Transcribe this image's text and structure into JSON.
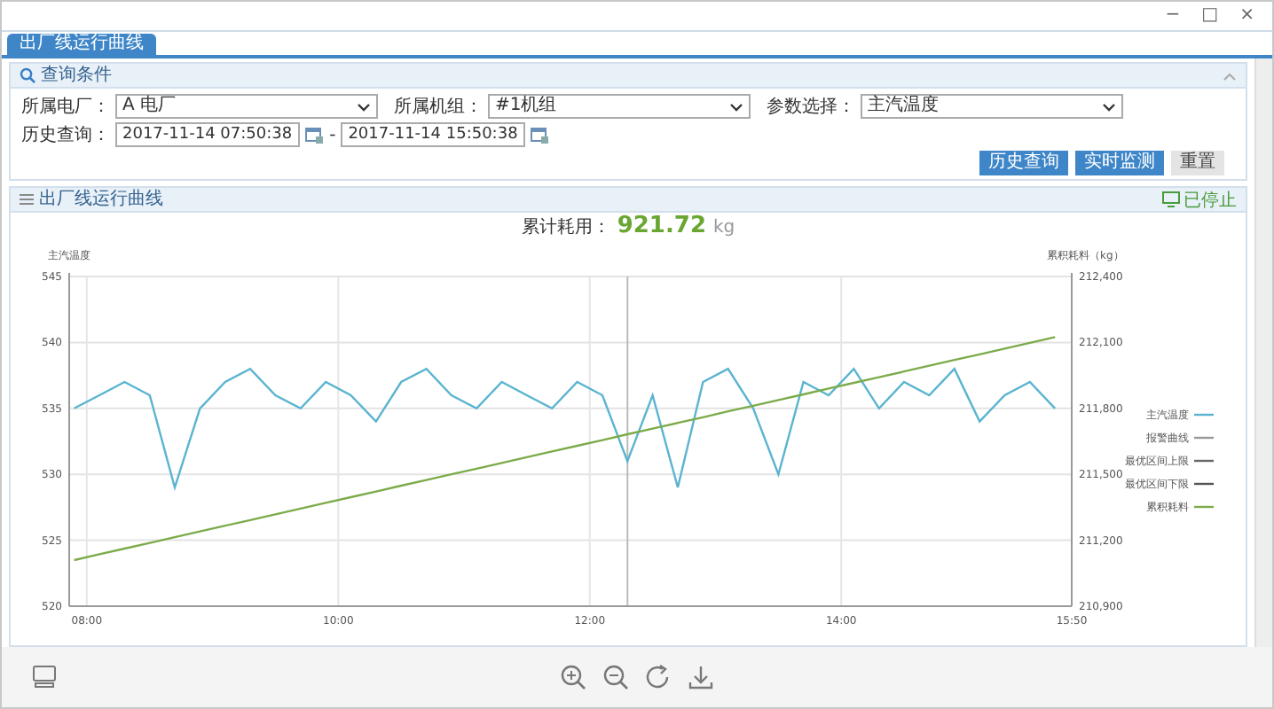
{
  "window": {
    "controls": [
      "−",
      "□",
      "×"
    ]
  },
  "tabs": [
    {
      "label": "出厂线运行曲线",
      "selected": true
    }
  ],
  "query_panel": {
    "title": "查询条件",
    "expanded": true,
    "fields": [
      {
        "label": "所属电厂：",
        "value": "A 电厂",
        "kind": "select"
      },
      {
        "label": "所属机组：",
        "value": "#1机组",
        "kind": "select"
      },
      {
        "label": "参数选择：",
        "value": "主汽温度",
        "kind": "select"
      }
    ],
    "time_range": {
      "label": "历史查询：",
      "start": "2017-11-14 07:50:38",
      "separator": "-",
      "end": "2017-11-14 15:50:38"
    },
    "buttons": [
      {
        "label": "历史查询",
        "kind": "primary"
      },
      {
        "label": "实时监测",
        "kind": "primary"
      },
      {
        "label": "重置",
        "kind": "plain"
      }
    ]
  },
  "chart_panel": {
    "title": "出厂线运行曲线",
    "status": "已停止",
    "total": {
      "label": "累计耗用：",
      "value": "921.72",
      "unit": "kg"
    },
    "chart_data": {
      "type": "line",
      "ylabel": "主汽温度",
      "y2label": "累积耗料（kg）",
      "xlim": [
        7.86,
        15.833
      ],
      "ylim": [
        520,
        545
      ],
      "y2lim": [
        210900,
        212400
      ],
      "xticks": [
        {
          "value": 8,
          "label": "08:00"
        },
        {
          "value": 10,
          "label": "10:00"
        },
        {
          "value": 12,
          "label": "12:00"
        },
        {
          "value": 14,
          "label": "14:00"
        },
        {
          "value": 15.833,
          "label": "15:50"
        }
      ],
      "yticks": [
        520,
        525,
        530,
        535,
        540,
        545
      ],
      "y2ticks": [
        {
          "value": 210900,
          "label": "210,900"
        },
        {
          "value": 211200,
          "label": "211,200"
        },
        {
          "value": 211500,
          "label": "211,500"
        },
        {
          "value": 211800,
          "label": "211,800"
        },
        {
          "value": 212100,
          "label": "212,100"
        },
        {
          "value": 212400,
          "label": "212,400"
        }
      ],
      "grid": true,
      "ref_lines": [
        {
          "axis": "x",
          "value": 12.3,
          "color": "#bbbbbb"
        }
      ],
      "x": [
        7.9,
        8.1,
        8.3,
        8.5,
        8.7,
        8.9,
        9.1,
        9.3,
        9.5,
        9.7,
        9.9,
        10.1,
        10.3,
        10.5,
        10.7,
        10.9,
        11.1,
        11.3,
        11.5,
        11.7,
        11.9,
        12.1,
        12.3,
        12.5,
        12.7,
        12.9,
        13.1,
        13.3,
        13.5,
        13.7,
        13.9,
        14.1,
        14.3,
        14.5,
        14.7,
        14.9,
        15.1,
        15.3,
        15.5,
        15.7
      ],
      "series": [
        {
          "name": "主汽温度",
          "color": "#5ab4d0",
          "values": [
            535,
            536,
            537,
            536,
            529,
            535,
            537,
            538,
            536,
            535,
            537,
            536,
            534,
            537,
            538,
            536,
            535,
            537,
            536,
            535,
            537,
            536,
            531,
            536,
            529,
            537,
            538,
            535,
            530,
            537,
            536,
            538,
            535,
            537,
            536,
            538,
            534,
            536,
            537,
            535
          ]
        },
        {
          "name": "报警曲线",
          "color": "#999999",
          "values": [
            null,
            null,
            null,
            null,
            null,
            null,
            null,
            null,
            null,
            null,
            null,
            null,
            null,
            null,
            null,
            null,
            null,
            null,
            null,
            null,
            null,
            null,
            null,
            null,
            null,
            null,
            null,
            null,
            null,
            null,
            null,
            null,
            null,
            null,
            null,
            null,
            null,
            null,
            null,
            null
          ]
        },
        {
          "name": "最优区间上限",
          "color": "#666666",
          "values": [
            null,
            null,
            null,
            null,
            null,
            null,
            null,
            null,
            null,
            null,
            null,
            null,
            null,
            null,
            null,
            null,
            null,
            null,
            null,
            null,
            null,
            null,
            null,
            null,
            null,
            null,
            null,
            null,
            null,
            null,
            null,
            null,
            null,
            null,
            null,
            null,
            null,
            null,
            null,
            null
          ]
        },
        {
          "name": "最优区间下限",
          "color": "#555555",
          "values": [
            null,
            null,
            null,
            null,
            null,
            null,
            null,
            null,
            null,
            null,
            null,
            null,
            null,
            null,
            null,
            null,
            null,
            null,
            null,
            null,
            null,
            null,
            null,
            null,
            null,
            null,
            null,
            null,
            null,
            null,
            null,
            null,
            null,
            null,
            null,
            null,
            null,
            null,
            null,
            null
          ]
        },
        {
          "name": "累积耗料",
          "color": "#7cab4a",
          "axis": "y2",
          "values": [
            211110,
            211136,
            211162,
            211188,
            211214,
            211240,
            211266,
            211292,
            211318,
            211344,
            211370,
            211396,
            211422,
            211448,
            211474,
            211500,
            211526,
            211552,
            211578,
            211604,
            211630,
            211656,
            211682,
            211708,
            211734,
            211760,
            211786,
            211812,
            211838,
            211864,
            211890,
            211916,
            211942,
            211968,
            211994,
            212020,
            212046,
            212072,
            212098,
            212124
          ]
        }
      ],
      "legend": true
    }
  },
  "toolbar": {
    "left_tools": [
      {
        "kind": "screen"
      }
    ],
    "center_tools": [
      {
        "kind": "zoom-in"
      },
      {
        "kind": "zoom-out"
      },
      {
        "kind": "rotate"
      },
      {
        "kind": "download"
      }
    ]
  }
}
